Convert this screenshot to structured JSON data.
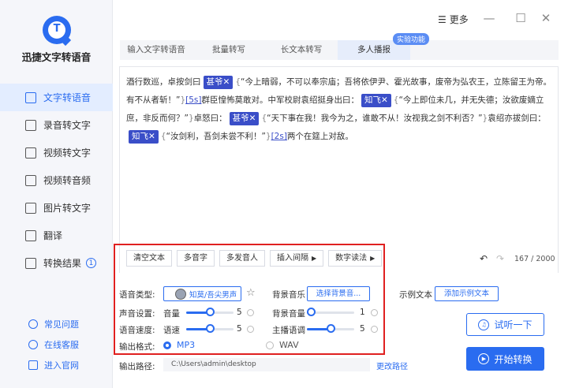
{
  "app": {
    "name": "迅捷文字转语音"
  },
  "titlebar": {
    "more": "更多",
    "minimize": "—",
    "maximize": "☐",
    "close": "✕"
  },
  "sidebar": {
    "items": [
      {
        "label": "文字转语音",
        "icon": "text-to-speech-icon"
      },
      {
        "label": "录音转文字",
        "icon": "recording-icon"
      },
      {
        "label": "视频转文字",
        "icon": "video-icon"
      },
      {
        "label": "视频转音频",
        "icon": "video-audio-icon"
      },
      {
        "label": "图片转文字",
        "icon": "image-icon"
      },
      {
        "label": "翻译",
        "icon": "translate-icon"
      },
      {
        "label": "转换结果",
        "icon": "result-icon",
        "badge": "1"
      }
    ],
    "footer": [
      {
        "label": "常见问题",
        "icon": "help-icon"
      },
      {
        "label": "在线客服",
        "icon": "service-icon"
      },
      {
        "label": "进入官网",
        "icon": "website-icon"
      }
    ]
  },
  "tabs": [
    {
      "label": "输入文字转语音"
    },
    {
      "label": "批量转写"
    },
    {
      "label": "长文本转写"
    },
    {
      "label": "多人播报"
    }
  ],
  "exp_badge": "实验功能",
  "editor": {
    "p1": "酒行数巡，卓按剑曰",
    "tag1": "甚爷✕",
    "b1": "{",
    "q1": "“今上暗弱，不可以奉宗庙；吾将依伊尹、霍光故事，废帝为弘农王，立陈留王为帝。有不从者斩！”",
    "b2": "}",
    "pause1": "[5s]",
    "p2": "群臣惶怖莫敢对。中军校尉袁绍挺身出曰：",
    "tag2": "知飞✕",
    "b3": "{",
    "q2": "“今上即位未几，并无失德；汝欲废嫡立庶，非反而何？”",
    "b4": "}",
    "p3": "卓怒曰：",
    "tag3": "甚爷✕",
    "b5": "{",
    "q3": "“天下事在我！我今为之，谁敢不从！汝视我之剑不利否？”",
    "b6": "}",
    "p4": "袁绍亦拔剑曰：",
    "tag4": "知飞✕",
    "b7": "{",
    "q4": "“汝剑利，吾剑未尝不利！”",
    "b8": "}",
    "pause2": "[2s]",
    "p5": "两个在筵上对敌。",
    "toolbar": {
      "clear": "清空文本",
      "polyphone": "多音字",
      "multi_speaker": "多发音人",
      "insert_pause": "插入间隔",
      "number_reading": "数字读法"
    },
    "counter": "167 / 2000"
  },
  "settings": {
    "voice_type_label": "语音类型:",
    "voice_name": "知莫/吾尖男声",
    "bg_music_label": "背景音乐",
    "bg_music_button": "选择背景音...",
    "sample_text_label": "示例文本",
    "sample_text_button": "添加示例文本",
    "sound_settings_label": "声音设置:",
    "volume_label": "音量",
    "volume_value": "5",
    "bg_volume_label": "背景音量",
    "bg_volume_value": "1",
    "speed_label": "语音速度:",
    "speed_sub_label": "语速",
    "speed_value": "5",
    "tone_label": "主播语调",
    "tone_value": "5",
    "format_label": "输出格式:",
    "format_mp3": "MP3",
    "format_wav": "WAV",
    "selected_format": "MP3",
    "output_path_label": "输出路径:",
    "output_path": "C:\\Users\\admin\\desktop",
    "change_path": "更改路径",
    "listen_button": "试听一下",
    "start_button": "开始转换",
    "volume_level": 0.5,
    "bg_volume_level": 0.0,
    "speed_level": 0.5,
    "tone_level": 0.5
  },
  "colors": {
    "accent": "#2a6cf0",
    "tag": "#3a4ec8",
    "highlight_box": "#e02020"
  }
}
